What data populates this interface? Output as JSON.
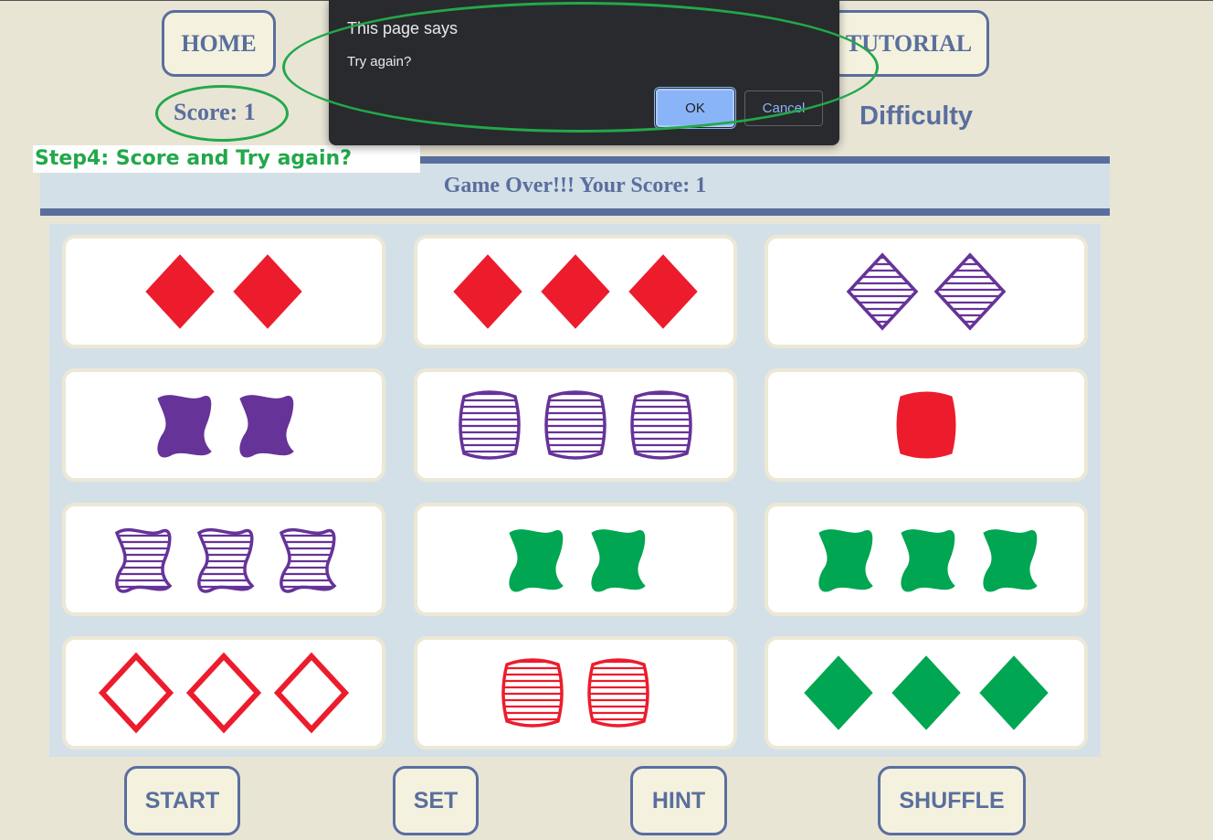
{
  "nav": {
    "home_label": "HOME",
    "tutorial_label": "TUTORIAL"
  },
  "score_label": "Score: 1",
  "difficulty_label": "Difficulty",
  "annotation": "Step4: Score and Try again?",
  "game_over_message": "Game Over!!! Your Score: 1",
  "cards": [
    {
      "count": 2,
      "shape": "diamond",
      "fill": "solid",
      "color": "red"
    },
    {
      "count": 3,
      "shape": "diamond",
      "fill": "solid",
      "color": "red"
    },
    {
      "count": 2,
      "shape": "diamond",
      "fill": "striped",
      "color": "purple"
    },
    {
      "count": 2,
      "shape": "squiggle",
      "fill": "solid",
      "color": "purple"
    },
    {
      "count": 3,
      "shape": "oval",
      "fill": "striped",
      "color": "purple"
    },
    {
      "count": 1,
      "shape": "oval",
      "fill": "solid",
      "color": "red"
    },
    {
      "count": 3,
      "shape": "squiggle",
      "fill": "striped",
      "color": "purple"
    },
    {
      "count": 2,
      "shape": "squiggle",
      "fill": "solid",
      "color": "green"
    },
    {
      "count": 3,
      "shape": "squiggle",
      "fill": "solid",
      "color": "green"
    },
    {
      "count": 3,
      "shape": "diamond",
      "fill": "open",
      "color": "red"
    },
    {
      "count": 2,
      "shape": "oval",
      "fill": "striped",
      "color": "red"
    },
    {
      "count": 3,
      "shape": "diamond",
      "fill": "solid",
      "color": "green"
    }
  ],
  "colors": {
    "red": "#ec1c2c",
    "purple": "#663399",
    "green": "#00a651",
    "accent": "#5a6e9e",
    "highlight": "#22a84a"
  },
  "controls": {
    "start_label": "START",
    "set_label": "SET",
    "hint_label": "HINT",
    "shuffle_label": "SHUFFLE"
  },
  "dialog": {
    "title": "This page says",
    "message": "Try again?",
    "ok_label": "OK",
    "cancel_label": "Cancel"
  }
}
